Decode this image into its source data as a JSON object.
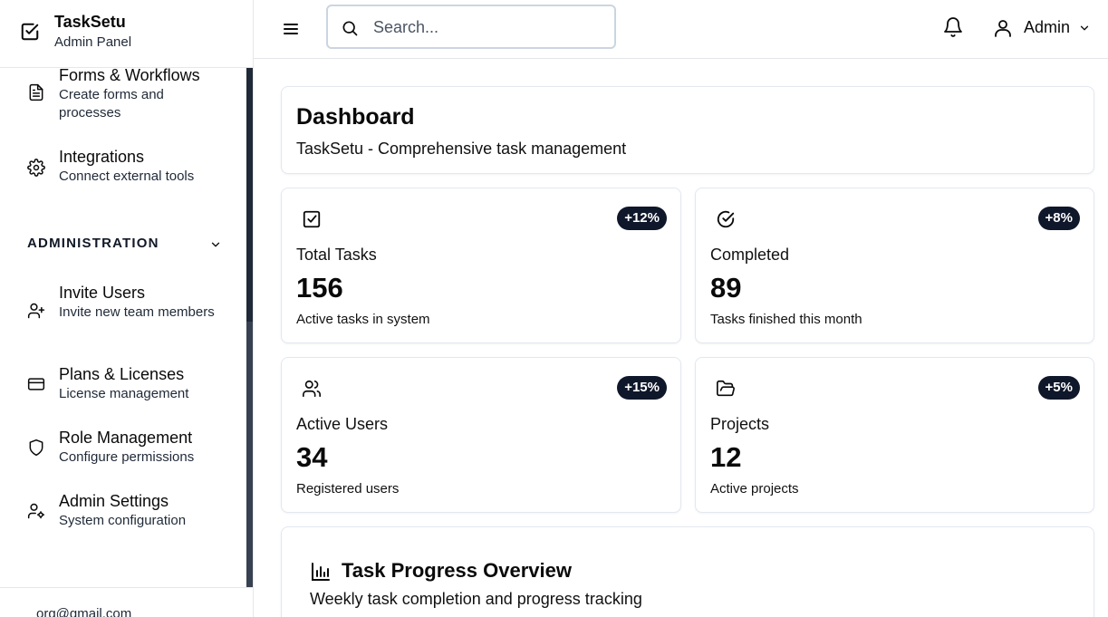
{
  "brand": {
    "title": "TaskSetu",
    "subtitle": "Admin Panel"
  },
  "sidebar": {
    "items": [
      {
        "icon": "file-text-icon",
        "label": "Forms & Workflows",
        "desc": "Create forms and processes"
      },
      {
        "icon": "gear-icon",
        "label": "Integrations",
        "desc": "Connect external tools"
      }
    ],
    "section": {
      "title": "ADMINISTRATION",
      "icon": "chevron-down-icon"
    },
    "admin_items": [
      {
        "icon": "user-plus-icon",
        "label": "Invite Users",
        "desc": "Invite new team members"
      },
      {
        "icon": "credit-card-icon",
        "label": "Plans & Licenses",
        "desc": "License management"
      },
      {
        "icon": "shield-icon",
        "label": "Role Management",
        "desc": "Configure permissions"
      },
      {
        "icon": "user-cog-icon",
        "label": "Admin Settings",
        "desc": "System configuration"
      }
    ],
    "footer_email": "org@gmail.com"
  },
  "header": {
    "search_placeholder": "Search...",
    "user_name": "Admin"
  },
  "dashboard": {
    "title": "Dashboard",
    "subtitle": "TaskSetu - Comprehensive task management"
  },
  "stats": [
    {
      "icon": "square-check-icon",
      "badge": "+12%",
      "title": "Total Tasks",
      "value": "156",
      "desc": "Active tasks in system"
    },
    {
      "icon": "circle-check-icon",
      "badge": "+8%",
      "title": "Completed",
      "value": "89",
      "desc": "Tasks finished this month"
    },
    {
      "icon": "users-icon",
      "badge": "+15%",
      "title": "Active Users",
      "value": "34",
      "desc": "Registered users"
    },
    {
      "icon": "folder-open-icon",
      "badge": "+5%",
      "title": "Projects",
      "value": "12",
      "desc": "Active projects"
    }
  ],
  "progress": {
    "icon": "bar-chart-icon",
    "title": "Task Progress Overview",
    "subtitle": "Weekly task completion and progress tracking"
  },
  "colors": {
    "badge_bg": "#0f172a",
    "border": "#e2e8f0",
    "scrollbar": "#1f2937"
  }
}
